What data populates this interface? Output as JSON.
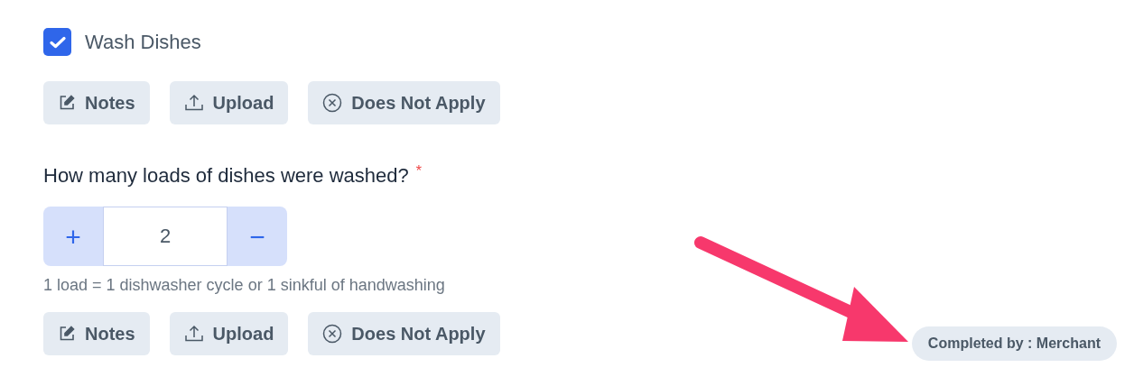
{
  "task": {
    "label": "Wash Dishes",
    "checked": true
  },
  "task_actions": [
    {
      "kind": "notes",
      "label": "Notes"
    },
    {
      "kind": "upload",
      "label": "Upload"
    },
    {
      "kind": "not-apply",
      "label": "Does Not Apply"
    }
  ],
  "question": {
    "text": "How many loads of dishes were washed?",
    "required_mark": "*",
    "increment": "+",
    "value": "2",
    "decrement": "−",
    "hint": "1 load = 1 dishwasher cycle or 1 sinkful of handwashing"
  },
  "question_actions": [
    {
      "kind": "notes",
      "label": "Notes"
    },
    {
      "kind": "upload",
      "label": "Upload"
    },
    {
      "kind": "not-apply",
      "label": "Does Not Apply"
    }
  ],
  "completed_by": "Completed by : Merchant"
}
